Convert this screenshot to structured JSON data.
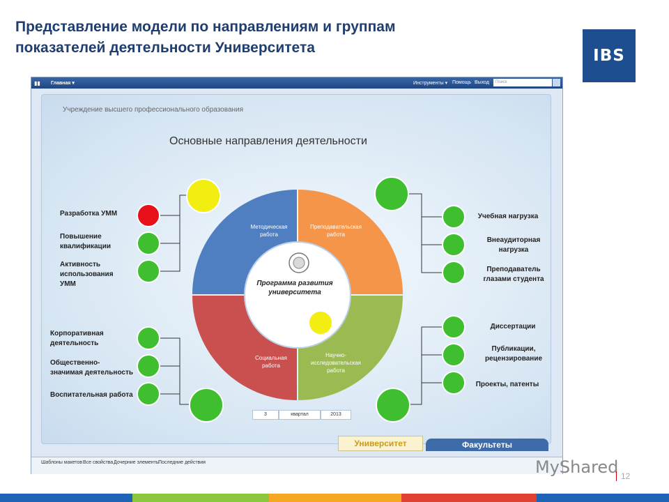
{
  "slide": {
    "title_line1": "Представление модели по направлениям и группам",
    "title_line2": "показателей деятельности Университета",
    "logo_text": "IBS",
    "page_number": "12",
    "watermark": "MyShared"
  },
  "app": {
    "topbar": {
      "home": "Главная ▾",
      "tools": "Инструменты ▾",
      "help": "Помощь",
      "exit": "Выход",
      "search_placeholder": "Поиск"
    },
    "statusbar": {
      "items": [
        "Шаблоны макетов",
        "Все свойства",
        "Дочерние элементы",
        "Последние действия"
      ]
    },
    "tabs": {
      "university": "Университет",
      "faculties": "Факультеты"
    },
    "period": {
      "number": "3",
      "unit": "квартал",
      "year": "2013"
    }
  },
  "dashboard": {
    "org": "Учреждение высшего профессионального образования",
    "title": "Основные направления деятельности",
    "center_label_1": "Программа развития",
    "center_label_2": "университета",
    "sectors": {
      "methodical": [
        "Методическая",
        "работа"
      ],
      "teaching": [
        "Преподавательская",
        "работа"
      ],
      "social": [
        "Социальная",
        "работа"
      ],
      "research": [
        "Научно-",
        "исследовательская",
        "работа"
      ]
    },
    "left_top": [
      {
        "label": [
          "Разработка УММ"
        ],
        "status": "red"
      },
      {
        "label": [
          "Повышение",
          "квалификации"
        ],
        "status": "green"
      },
      {
        "label": [
          "Активность",
          "использования",
          "УММ"
        ],
        "status": "green"
      }
    ],
    "left_bottom": [
      {
        "label": [
          "Корпоративная",
          "деятельность"
        ],
        "status": "green"
      },
      {
        "label": [
          "Общественно-",
          "значимая деятельность"
        ],
        "status": "green"
      },
      {
        "label": [
          "Воспитательная работа"
        ],
        "status": "green"
      }
    ],
    "right_top": [
      {
        "label": [
          "Учебная нагрузка"
        ],
        "status": "green"
      },
      {
        "label": [
          "Внеаудиторная",
          "нагрузка"
        ],
        "status": "green"
      },
      {
        "label": [
          "Преподаватель",
          "глазами студента"
        ],
        "status": "green"
      }
    ],
    "right_bottom": [
      {
        "label": [
          "Диссертации"
        ],
        "status": "green"
      },
      {
        "label": [
          "Публикации,",
          "рецензирование"
        ],
        "status": "green"
      },
      {
        "label": [
          "Проекты, патенты"
        ],
        "status": "green"
      }
    ]
  },
  "colors": {
    "methodical": "#4f7fc0",
    "teaching": "#f4954a",
    "social": "#c9504f",
    "research": "#9bbb52",
    "green": "#3fbf2f",
    "red": "#e8101a",
    "yellow": "#f2ee12"
  }
}
